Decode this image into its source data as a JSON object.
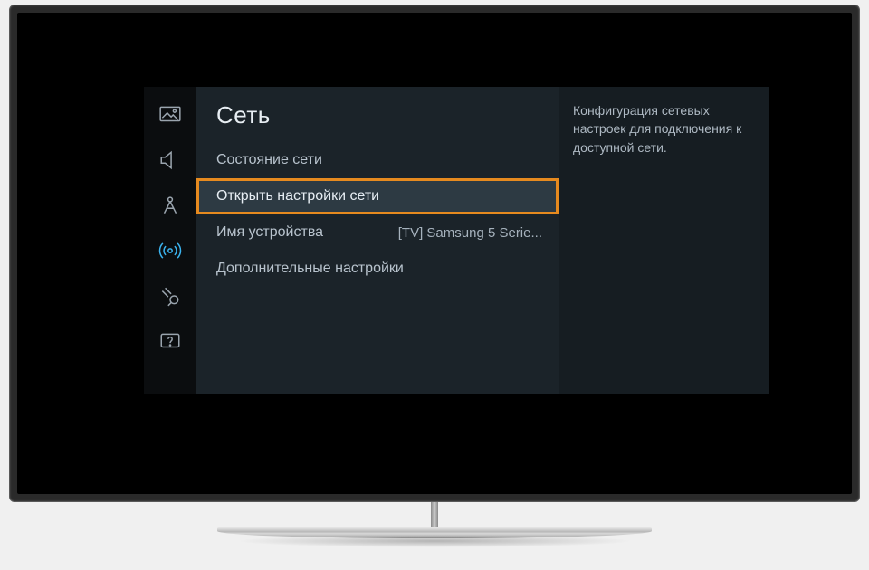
{
  "title": "Сеть",
  "sidebar_icons": [
    {
      "name": "picture-icon"
    },
    {
      "name": "sound-icon"
    },
    {
      "name": "broadcast-icon"
    },
    {
      "name": "network-icon",
      "active": true
    },
    {
      "name": "system-icon"
    },
    {
      "name": "support-icon"
    }
  ],
  "menu": {
    "items": [
      {
        "label": "Состояние сети",
        "value": "",
        "highlighted": false
      },
      {
        "label": "Открыть настройки сети",
        "value": "",
        "highlighted": true
      },
      {
        "label": "Имя устройства",
        "value": "[TV] Samsung 5 Serie...",
        "highlighted": false
      },
      {
        "label": "Дополнительные настройки",
        "value": "",
        "highlighted": false
      }
    ]
  },
  "description": "Конфигурация сетевых настроек для подключения к доступной сети."
}
